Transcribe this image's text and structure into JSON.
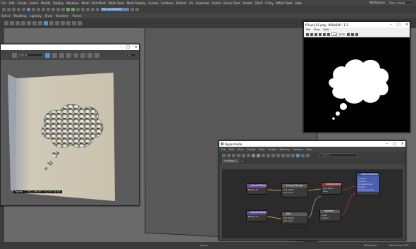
{
  "app": {
    "menus": [
      "File",
      "Edit",
      "Create",
      "Select",
      "Modify",
      "Display",
      "Windows",
      "Mesh",
      "Edit Mesh",
      "Mesh Tools",
      "Mesh Display",
      "Curves",
      "Surfaces",
      "Deform",
      "UV",
      "Generate",
      "Cache",
      "Bonus Tools",
      "Arnold",
      "SOUP",
      "SOuP",
      "V-Ray",
      "MASH Tools",
      "Help"
    ],
    "menus2": [
      "Mesh",
      "Edit Mesh",
      "Mesh Tools",
      "Mesh Display",
      "Curves",
      "Surfaces",
      "Deform",
      "UV",
      "Generate",
      "Cache",
      "Bonus Tools",
      "Arnold",
      "SOuP",
      "V-Ray",
      "MASH Tools",
      "Help"
    ],
    "workspace_label": "Workspace",
    "workspace_value": "Maya Classic",
    "live_surface": "No Live Surface",
    "submenus": [
      "Select",
      "Modeling",
      "Lighting",
      "Show",
      "Renderer",
      "Panels"
    ],
    "status_left": "",
    "status_mid": "persp",
    "status_right1": "Wireframe",
    "status_right2": "Karlo Maya FPS",
    "zoom": "x 1.00"
  },
  "render_view": {
    "title": "",
    "toolbar_field": "persp",
    "zoom": "1:1",
    "frame_info": "Frame: 1   2022-09-09   17:02:37   00:00"
  },
  "image_window": {
    "title": "fCloud_01.png - 960x640 - 1:1",
    "menus": [
      "File",
      "View",
      "Help"
    ],
    "zoom": "1:1",
    "zoom_pct": "100%"
  },
  "hypershade": {
    "title": "Hypershade",
    "menus": [
      "File",
      "Edit",
      "View",
      "Create",
      "Tabs",
      "Graph",
      "Window",
      "Options",
      "Help"
    ],
    "tab": "Untitled_1",
    "tab_plus": "+",
    "search_placeholder": "Search...",
    "nodes": [
      {
        "id": "place2d_1",
        "title": "place2dTexture1",
        "color": "#6e4fa0",
        "rows": [
          "UV",
          "Out UV"
        ]
      },
      {
        "id": "file1",
        "title": "fcloud_01.png",
        "color": "#5a5a5a",
        "rows": [
          "Out Alpha",
          "Out Color"
        ]
      },
      {
        "id": "displace",
        "title": "aiDisplacement1",
        "color": "#8a3a3a",
        "rows": [
          "Vec Space",
          "Disp"
        ]
      },
      {
        "id": "sg",
        "title": "aiStandardSG1",
        "color": "#3a4fa0",
        "rows": [
          "Surface",
          "Volume",
          "Displacement Shader",
          "Surface Shader"
        ]
      },
      {
        "id": "place2d_2",
        "title": "place2dTexture2",
        "color": "#6e4fa0",
        "rows": [
          "UV",
          "Out UV"
        ]
      },
      {
        "id": "file2",
        "title": "file2",
        "color": "#5a5a5a",
        "rows": [
          "Out Alpha",
          "Out Color"
        ]
      },
      {
        "id": "reverse",
        "title": "reverse1",
        "color": "#5a5a5a",
        "rows": [
          "Input",
          "Output"
        ]
      }
    ]
  },
  "colors": {
    "accent": "#5b8fc4",
    "node_purple": "#6e4fa0",
    "node_blue": "#3a4fa0",
    "node_red": "#8a3a3a",
    "wire_yellow": "#e0c040"
  }
}
